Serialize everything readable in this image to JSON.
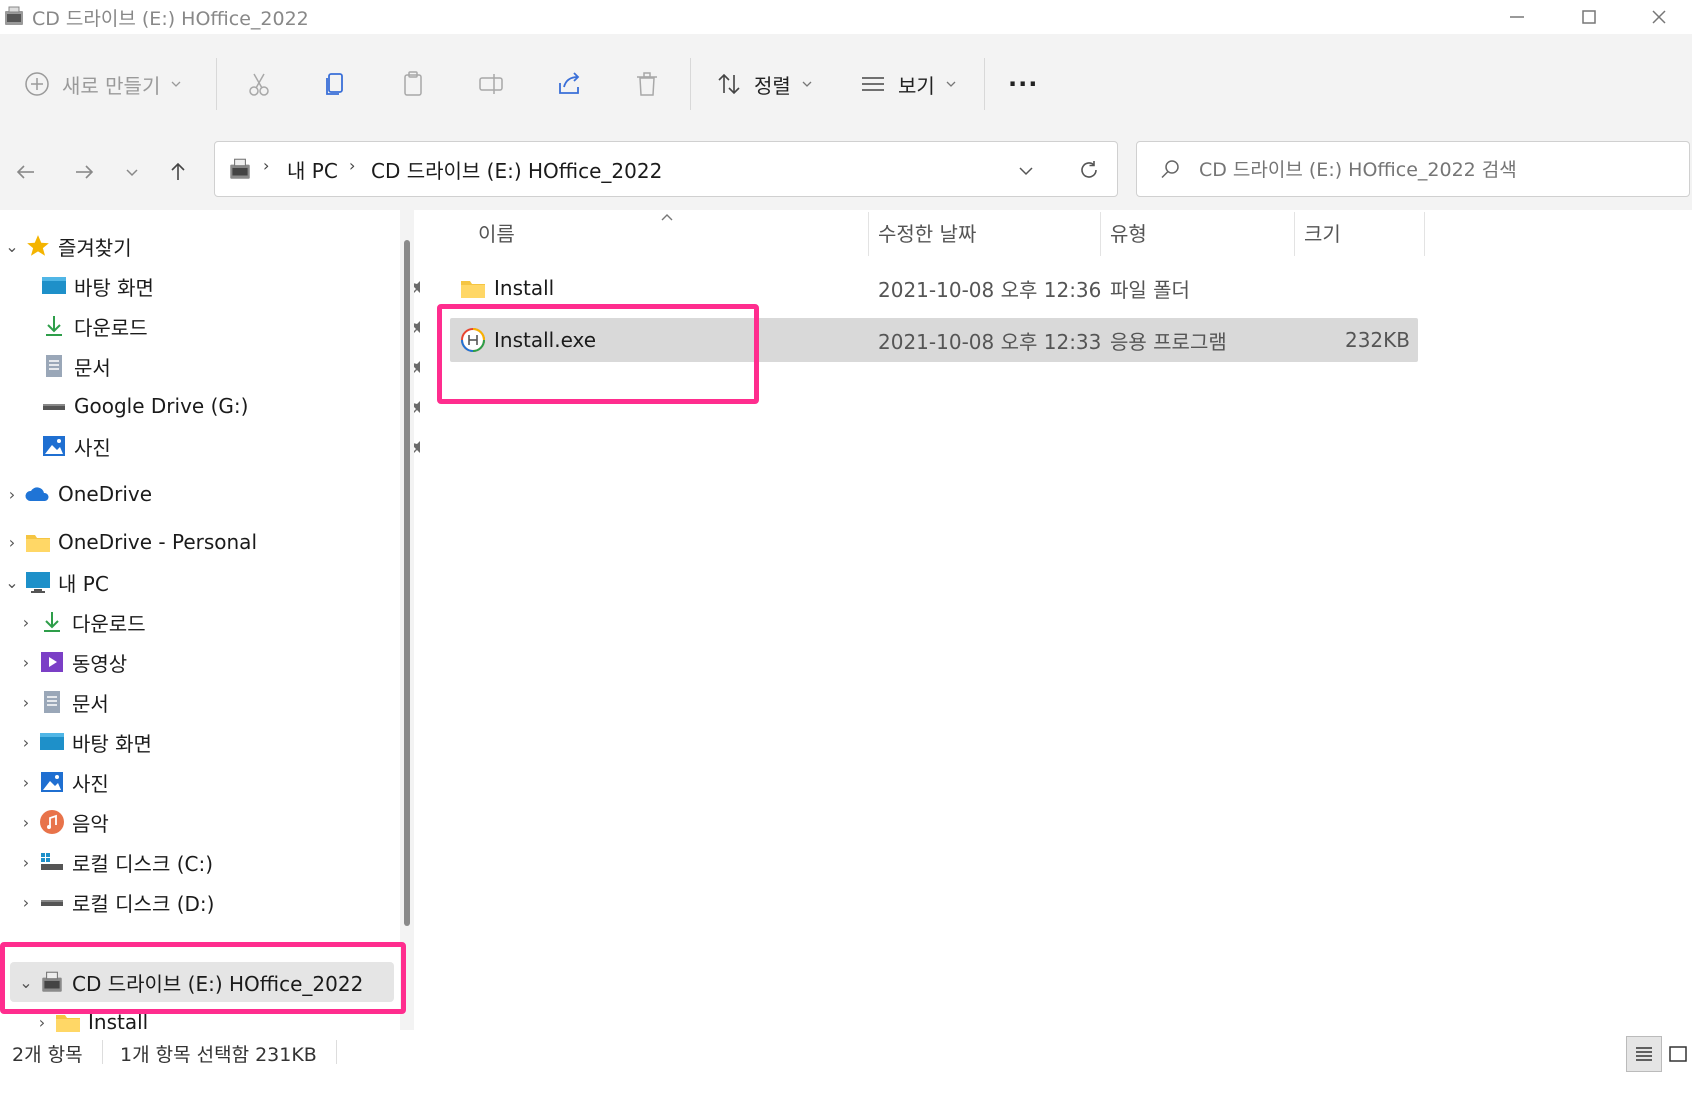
{
  "window": {
    "title": "CD 드라이브 (E:) HOffice_2022"
  },
  "toolbar": {
    "new_label": "새로 만들기",
    "sort_label": "정렬",
    "view_label": "보기",
    "more_label": "···"
  },
  "address": {
    "crumbs": [
      "내 PC",
      "CD 드라이브 (E:) HOffice_2022"
    ],
    "search_placeholder": "CD 드라이브 (E:) HOffice_2022 검색"
  },
  "sidebar": {
    "favorites": {
      "label": "즐겨찾기",
      "items": [
        {
          "label": "바탕 화면",
          "icon": "desktop-icon"
        },
        {
          "label": "다운로드",
          "icon": "download-icon"
        },
        {
          "label": "문서",
          "icon": "document-icon"
        },
        {
          "label": "Google Drive (G:)",
          "icon": "drive-icon"
        },
        {
          "label": "사진",
          "icon": "pictures-icon"
        }
      ]
    },
    "onedrive": "OneDrive",
    "onedrive_personal": "OneDrive - Personal",
    "thispc": {
      "label": "내 PC",
      "items": [
        {
          "label": "다운로드",
          "icon": "download-icon"
        },
        {
          "label": "동영상",
          "icon": "videos-icon"
        },
        {
          "label": "문서",
          "icon": "document-icon"
        },
        {
          "label": "바탕 화면",
          "icon": "desktop-icon"
        },
        {
          "label": "사진",
          "icon": "pictures-icon"
        },
        {
          "label": "음악",
          "icon": "music-icon"
        },
        {
          "label": "로컬 디스크 (C:)",
          "icon": "windows-drive-icon"
        },
        {
          "label": "로컬 디스크 (D:)",
          "icon": "drive-icon"
        }
      ]
    },
    "cd_drive": "CD 드라이브 (E:) HOffice_2022",
    "cd_child": "Install"
  },
  "columns": {
    "name": "이름",
    "modified": "수정한 날짜",
    "type": "유형",
    "size": "크기"
  },
  "files": [
    {
      "name": "Install",
      "modified": "2021-10-08 오후 12:36",
      "type": "파일 폴더",
      "size": "",
      "icon": "folder-icon"
    },
    {
      "name": "Install.exe",
      "modified": "2021-10-08 오후 12:33",
      "type": "응용 프로그램",
      "size": "232KB",
      "icon": "hancom-installer-icon"
    }
  ],
  "status": {
    "count": "2개 항목",
    "selected": "1개 항목 선택함 231KB"
  },
  "colors": {
    "highlight": "#ff2d8e",
    "selected_row": "#d9d9d9",
    "toolbar_bg": "#f3f3f3"
  }
}
